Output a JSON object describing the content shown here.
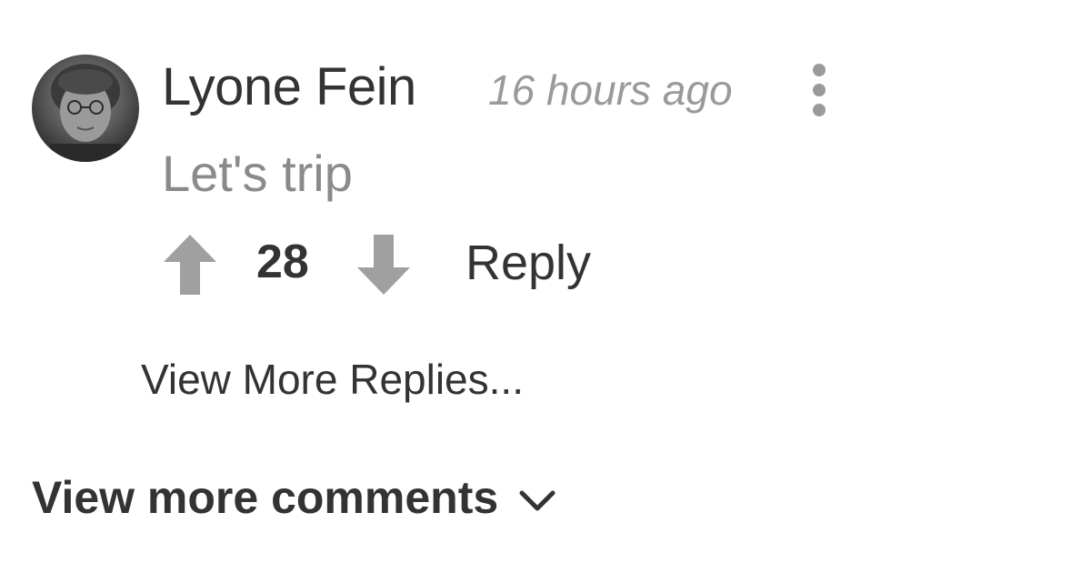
{
  "comment": {
    "author": "Lyone Fein",
    "timestamp": "16 hours ago",
    "text": "Let's trip",
    "vote_count": "28",
    "reply_label": "Reply",
    "avatar_icon": "user-avatar",
    "more_icon": "more-vertical-icon",
    "upvote_icon": "arrow-up-icon",
    "downvote_icon": "arrow-down-icon"
  },
  "replies": {
    "view_more_label": "View More Replies..."
  },
  "footer": {
    "view_more_comments_label": "View more comments",
    "chevron_icon": "chevron-down-icon"
  },
  "colors": {
    "text_primary": "#333333",
    "text_muted": "#9a9a9a",
    "comment_text": "#8a8a8a",
    "icon_gray": "#a0a0a0",
    "background": "#ffffff"
  }
}
